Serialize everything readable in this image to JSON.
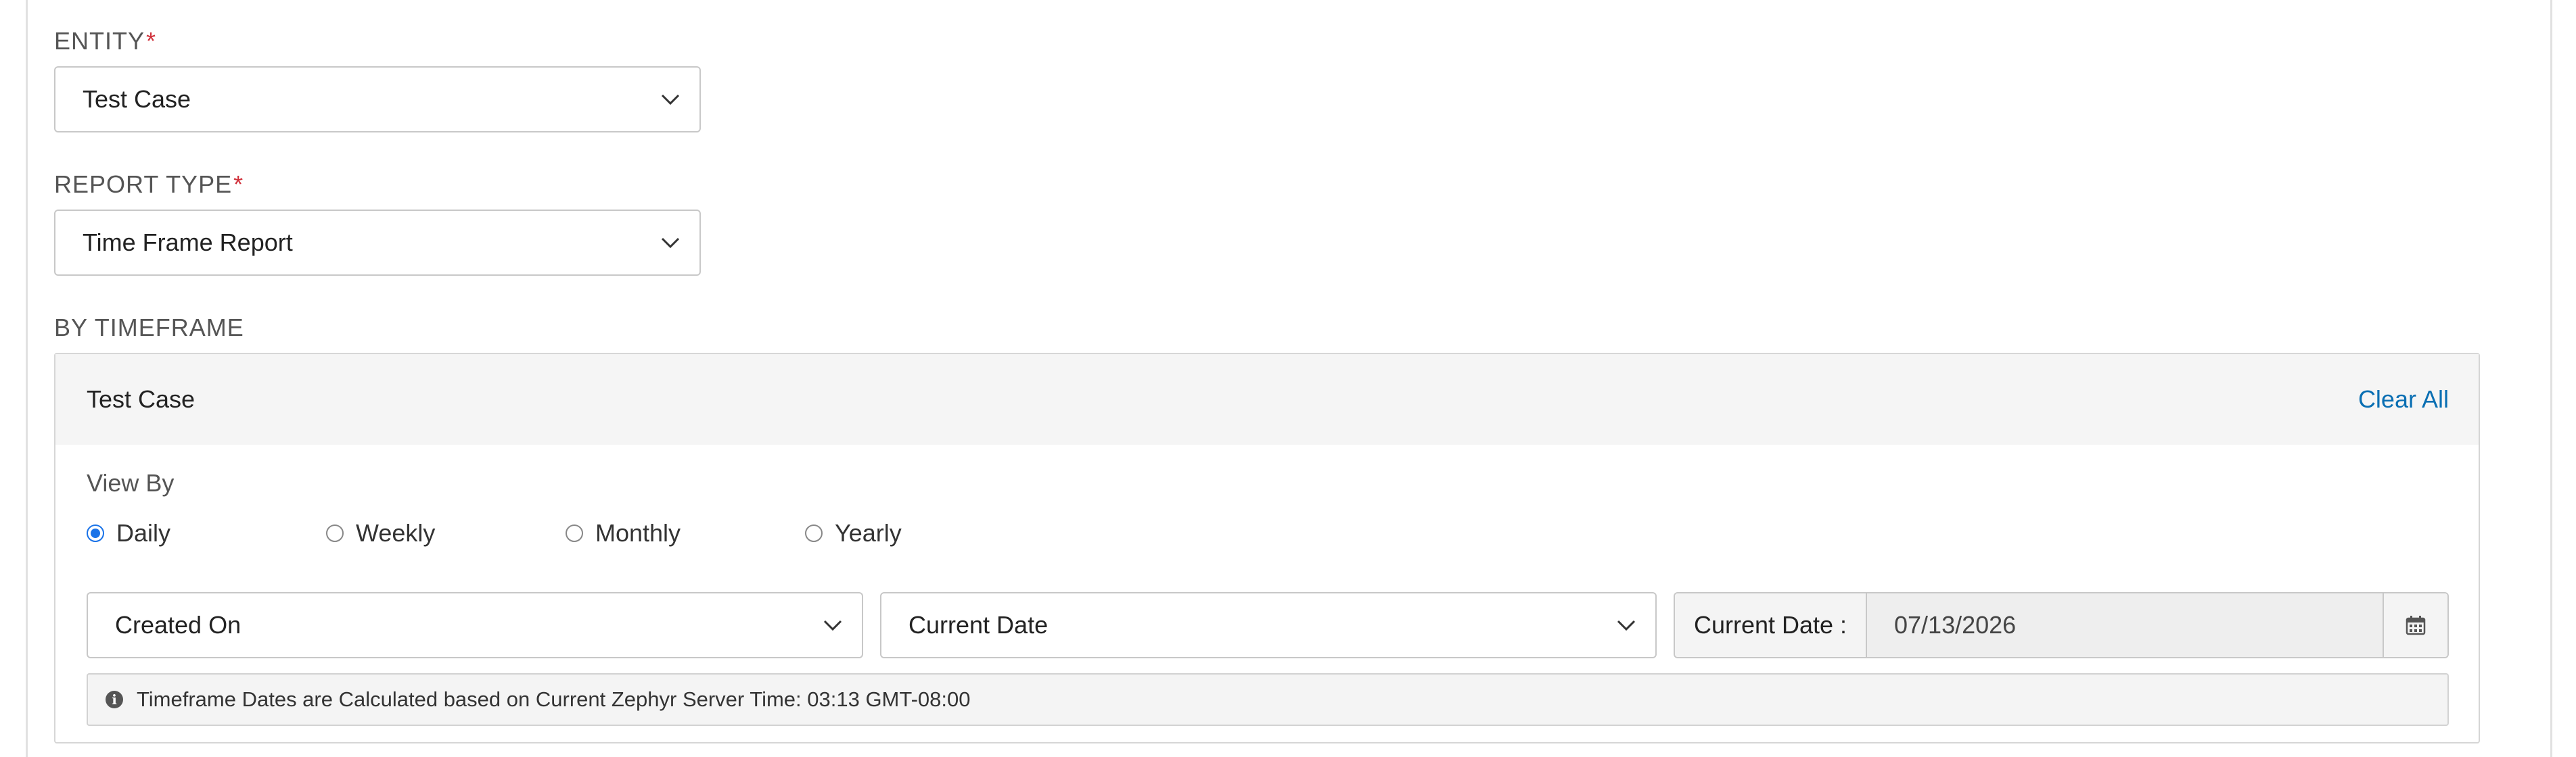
{
  "form": {
    "entity": {
      "label": "ENTITY",
      "required_mark": "*",
      "value": "Test Case"
    },
    "report_type": {
      "label": "REPORT TYPE",
      "required_mark": "*",
      "value": "Time Frame Report"
    },
    "by_timeframe_label": "BY TIMEFRAME"
  },
  "timeframe_panel": {
    "title": "Test Case",
    "clear_all": "Clear All",
    "view_by_label": "View By",
    "view_by_options": [
      "Daily",
      "Weekly",
      "Monthly",
      "Yearly"
    ],
    "view_by_selected": "Daily",
    "date_field_select": "Created On",
    "date_range_select": "Current Date",
    "current_date_label": "Current Date :",
    "current_date_value": "07/13/2026",
    "calendar_icon": "calendar-icon",
    "info_icon": "info-icon",
    "info_text": "Timeframe Dates are Calculated based on Current Zephyr Server Time: 03:13 GMT-08:00"
  },
  "colors": {
    "required": "#d0303a",
    "link": "#0a6fb3",
    "radio_selected": "#1a73e8",
    "panel_header_bg": "#f5f5f5"
  }
}
